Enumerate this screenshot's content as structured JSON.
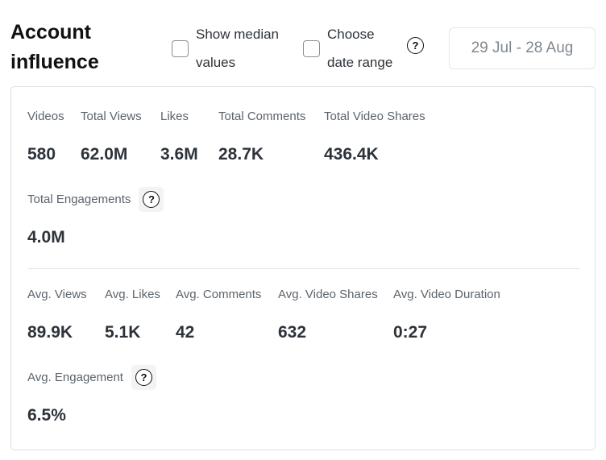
{
  "header": {
    "title_line1": "Account",
    "title_line2": "influence",
    "median_checkbox_label_line1": "Show median",
    "median_checkbox_label_line2": "values",
    "date_checkbox_label_line1": "Choose",
    "date_checkbox_label_line2": "date range",
    "date_range": "29 Jul - 28 Aug"
  },
  "totals": [
    {
      "label": "Videos",
      "value": "580"
    },
    {
      "label": "Total Views",
      "value": "62.0M"
    },
    {
      "label": "Likes",
      "value": "3.6M"
    },
    {
      "label": "Total Comments",
      "value": "28.7K"
    },
    {
      "label": "Total Video Shares",
      "value": "436.4K"
    }
  ],
  "total_engagements": {
    "label": "Total Engagements",
    "value": "4.0M"
  },
  "averages": [
    {
      "label": "Avg. Views",
      "value": "89.9K"
    },
    {
      "label": "Avg. Likes",
      "value": "5.1K"
    },
    {
      "label": "Avg. Comments",
      "value": "42"
    },
    {
      "label": "Avg. Video Shares",
      "value": "632"
    },
    {
      "label": "Avg. Video Duration",
      "value": "0:27"
    }
  ],
  "avg_engagement": {
    "label": "Avg. Engagement",
    "value": "6.5%"
  },
  "icons": {
    "help": "question-circle-icon"
  }
}
